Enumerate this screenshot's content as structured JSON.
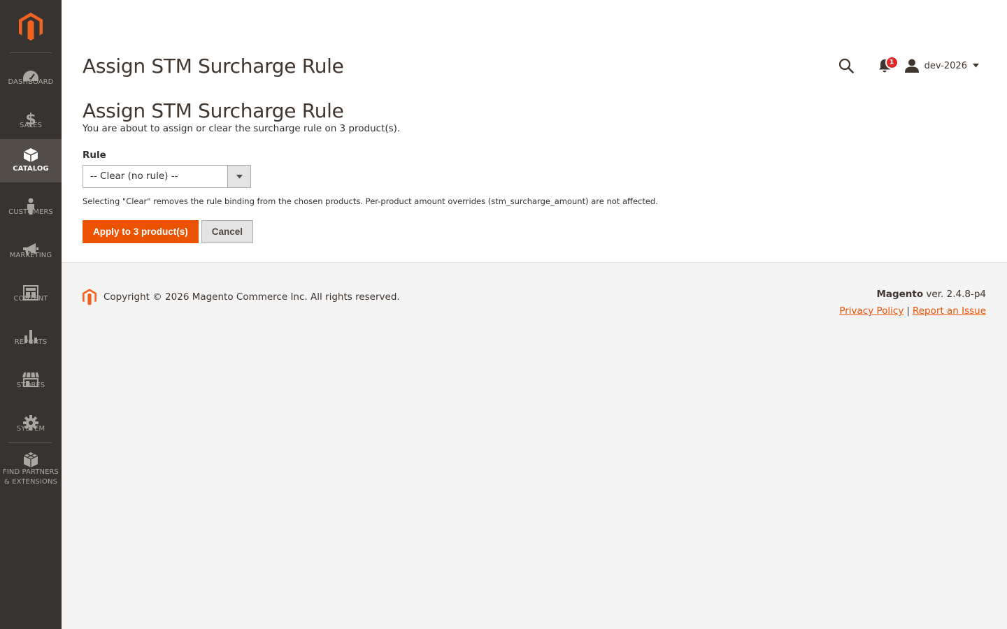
{
  "sidebar": {
    "items": [
      {
        "key": "dashboard",
        "label": "DASHBOARD",
        "icon": "gauge-icon"
      },
      {
        "key": "sales",
        "label": "SALES",
        "icon": "dollar-icon"
      },
      {
        "key": "catalog",
        "label": "CATALOG",
        "icon": "box-icon",
        "active": true
      },
      {
        "key": "customers",
        "label": "CUSTOMERS",
        "icon": "person-icon"
      },
      {
        "key": "marketing",
        "label": "MARKETING",
        "icon": "megaphone-icon"
      },
      {
        "key": "content",
        "label": "CONTENT",
        "icon": "layout-icon"
      },
      {
        "key": "reports",
        "label": "REPORTS",
        "icon": "bar-chart-icon"
      },
      {
        "key": "stores",
        "label": "STORES",
        "icon": "storefront-icon"
      },
      {
        "key": "system",
        "label": "SYSTEM",
        "icon": "gear-icon"
      },
      {
        "key": "partners",
        "label_line1": "FIND PARTNERS",
        "label_line2": "& EXTENSIONS",
        "icon": "cubes-icon"
      }
    ]
  },
  "header": {
    "title": "Assign STM Surcharge Rule",
    "notification_count": "1",
    "username": "dev-2026"
  },
  "form": {
    "heading": "Assign STM Surcharge Rule",
    "lead": "You are about to assign or clear the surcharge rule on 3 product(s).",
    "rule_label": "Rule",
    "rule_selected": "-- Clear (no rule) --",
    "note": "Selecting \"Clear\" removes the rule binding from the chosen products. Per-product amount overrides (stm_surcharge_amount) are not affected.",
    "apply_label": "Apply to 3 product(s)",
    "cancel_label": "Cancel"
  },
  "footer": {
    "copyright": "Copyright © 2026 Magento Commerce Inc. All rights reserved.",
    "brand": "Magento",
    "version": " ver. 2.4.8-p4",
    "privacy": "Privacy Policy",
    "separator": "|",
    "report": "Report an Issue"
  },
  "colors": {
    "accent": "#eb5202",
    "sidebar_bg": "#373330",
    "sidebar_active": "#524d49",
    "badge": "#e22626"
  }
}
